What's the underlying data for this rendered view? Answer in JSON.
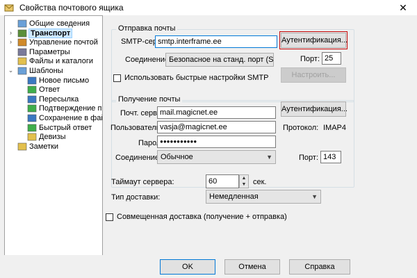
{
  "window": {
    "title": "Свойства почтового ящика",
    "close_glyph": "✕"
  },
  "tree": {
    "items": [
      {
        "label": "Общие сведения",
        "icon": "general-icon",
        "level": 1
      },
      {
        "label": "Транспорт",
        "icon": "transport-icon",
        "level": 1,
        "selected": true,
        "expander": "›"
      },
      {
        "label": "Управление почтой",
        "icon": "mail-management-icon",
        "level": 1,
        "expander": "›"
      },
      {
        "label": "Параметры",
        "icon": "parameters-icon",
        "level": 1
      },
      {
        "label": "Файлы и каталоги",
        "icon": "folder-icon",
        "level": 1
      },
      {
        "label": "Шаблоны",
        "icon": "templates-icon",
        "level": 1,
        "expander": "⌄"
      },
      {
        "label": "Новое письмо",
        "icon": "new-letter-icon",
        "level": 2
      },
      {
        "label": "Ответ",
        "icon": "reply-icon",
        "level": 2
      },
      {
        "label": "Пересылка",
        "icon": "forward-icon",
        "level": 2
      },
      {
        "label": "Подтверждение проч",
        "icon": "read-receipt-icon",
        "level": 2
      },
      {
        "label": "Сохранение в файл",
        "icon": "save-file-icon",
        "level": 2
      },
      {
        "label": "Быстрый ответ",
        "icon": "quick-reply-icon",
        "level": 2
      },
      {
        "label": "Девизы",
        "icon": "mottos-icon",
        "level": 2
      },
      {
        "label": "Заметки",
        "icon": "notes-icon",
        "level": 1
      }
    ]
  },
  "send": {
    "legend": "Отправка почты",
    "smtp_label": "SMTP-сервер:",
    "smtp_value": "smtp.interframe.ee",
    "auth_button": "Аутентификация...",
    "connection_label": "Соединение:",
    "connection_value": "Безопасное на станд. порт (START",
    "port_label": "Порт:",
    "port_value": "25",
    "quick_smtp_label": "Использовать быстрые настройки SMTP",
    "configure_button": "Настроить..."
  },
  "receive": {
    "legend": "Получение почты",
    "server_label": "Почт. сервер:",
    "server_value": "mail.magicnet.ee",
    "auth_button": "Аутентификация...",
    "user_label": "Пользователь:",
    "user_value": "vasja@magicnet.ee",
    "protocol_label": "Протокол:",
    "protocol_value": "IMAP4",
    "password_label": "Пароль:",
    "password_value": "●●●●●●●●●●●",
    "connection_label": "Соединение:",
    "connection_value": "Обычное",
    "port_label": "Порт:",
    "port_value": "143"
  },
  "timeout": {
    "label": "Таймаут сервера:",
    "value": "60",
    "unit": "сек."
  },
  "delivery": {
    "label": "Тип доставки:",
    "value": "Немедленная"
  },
  "combined": {
    "label": "Совмещенная доставка (получение + отправка)"
  },
  "footer": {
    "ok": "OK",
    "cancel": "Отмена",
    "help": "Справка"
  }
}
